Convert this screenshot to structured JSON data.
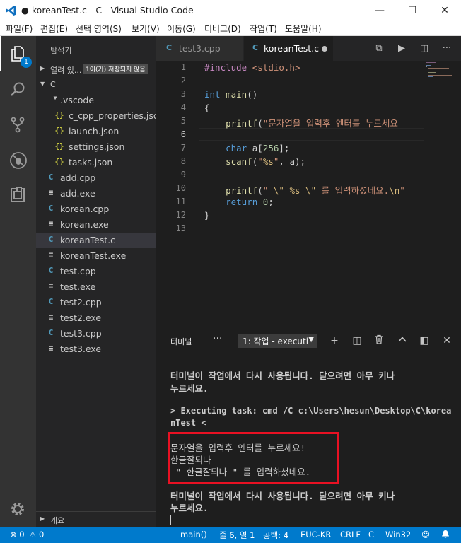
{
  "window": {
    "title": "● koreanTest.c - C - Visual Studio Code",
    "minimize": "—",
    "maximize": "☐",
    "close": "✕"
  },
  "menu": [
    "파일(F)",
    "편집(E)",
    "선택 영역(S)",
    "보기(V)",
    "이동(G)",
    "디버그(D)",
    "작업(T)",
    "도움말(H)"
  ],
  "activity": {
    "explorer_badge": "1",
    "icons": [
      "files-icon",
      "search-icon",
      "source-control-icon",
      "debug-icon",
      "extensions-icon",
      "settings-icon"
    ]
  },
  "sidebar": {
    "title": "탐색기",
    "open_editors": {
      "label": "열려 있...",
      "dirty_badge": "1이(가) 저장되지 않음"
    },
    "folder": "C",
    "items": [
      {
        "label": ".vscode",
        "type": "folder",
        "icon": ""
      },
      {
        "label": "c_cpp_properties.json",
        "type": "json",
        "icon": "{}"
      },
      {
        "label": "launch.json",
        "type": "json",
        "icon": "{}"
      },
      {
        "label": "settings.json",
        "type": "json",
        "icon": "{}"
      },
      {
        "label": "tasks.json",
        "type": "json",
        "icon": "{}"
      },
      {
        "label": "add.cpp",
        "type": "cpp",
        "icon": "C"
      },
      {
        "label": "add.exe",
        "type": "exe",
        "icon": "≡"
      },
      {
        "label": "korean.cpp",
        "type": "cpp",
        "icon": "C"
      },
      {
        "label": "korean.exe",
        "type": "exe",
        "icon": "≡"
      },
      {
        "label": "koreanTest.c",
        "type": "c",
        "icon": "C",
        "selected": true
      },
      {
        "label": "koreanTest.exe",
        "type": "exe",
        "icon": "≡"
      },
      {
        "label": "test.cpp",
        "type": "cpp",
        "icon": "C"
      },
      {
        "label": "test.exe",
        "type": "exe",
        "icon": "≡"
      },
      {
        "label": "test2.cpp",
        "type": "cpp",
        "icon": "C"
      },
      {
        "label": "test2.exe",
        "type": "exe",
        "icon": "≡"
      },
      {
        "label": "test3.cpp",
        "type": "cpp",
        "icon": "C"
      },
      {
        "label": "test3.exe",
        "type": "exe",
        "icon": "≡"
      }
    ],
    "outline": "개요"
  },
  "tabs": [
    {
      "label": "test3.cpp",
      "icon": "C",
      "active": false
    },
    {
      "label": "koreanTest.c",
      "icon": "C",
      "active": true,
      "dirty": true
    }
  ],
  "editor": {
    "current_line": 6,
    "lines": [
      {
        "n": "1",
        "code": "#include <stdio.h>"
      },
      {
        "n": "2",
        "code": ""
      },
      {
        "n": "3",
        "code": "int main()"
      },
      {
        "n": "4",
        "code": "{"
      },
      {
        "n": "5",
        "code": "    printf(\"문자열을 입력후 엔터를 누르세요"
      },
      {
        "n": "6",
        "code": ""
      },
      {
        "n": "7",
        "code": "    char a[256];"
      },
      {
        "n": "8",
        "code": "    scanf(\"%s\", a);"
      },
      {
        "n": "9",
        "code": ""
      },
      {
        "n": "10",
        "code": "    printf(\" \\\" %s \\\" 를 입력하셨네요.\\n\""
      },
      {
        "n": "11",
        "code": "    return 0;"
      },
      {
        "n": "12",
        "code": "}"
      },
      {
        "n": "13",
        "code": ""
      }
    ]
  },
  "panel": {
    "tab": "터미널",
    "more": "···",
    "terminal_select": "1: 작업 - executi",
    "lines": [
      {
        "text": "터미널이 작업에서 다시 사용됩니다. 닫으려면 아무 키나",
        "bold": true
      },
      {
        "text": "누르세요.",
        "bold": true
      },
      {
        "text": "",
        "bold": false
      },
      {
        "text": "> Executing task: cmd /C c:\\Users\\hesun\\Desktop\\C\\korea",
        "bold": true
      },
      {
        "text": "nTest <",
        "bold": true
      },
      {
        "text": "",
        "bold": false
      },
      {
        "text": "문자열을 입력후 엔터를 누르세요!",
        "bold": false
      },
      {
        "text": "한글잘되나",
        "bold": false
      },
      {
        "text": " \" 한글잘되나 \" 를 입력하셨네요.",
        "bold": false
      },
      {
        "text": "",
        "bold": false
      },
      {
        "text": "터미널이 작업에서 다시 사용됩니다. 닫으려면 아무 키나",
        "bold": true
      },
      {
        "text": "누르세요.",
        "bold": true
      }
    ]
  },
  "status": {
    "errors": "0",
    "warnings": "0",
    "function": "main()",
    "position": "줄 6, 열 1",
    "spaces": "공백: 4",
    "encoding": "EUC-KR",
    "eol": "CRLF",
    "language": "C",
    "platform": "Win32"
  },
  "colors": {
    "accent": "#007acc",
    "highlight_box": "#e81123"
  }
}
